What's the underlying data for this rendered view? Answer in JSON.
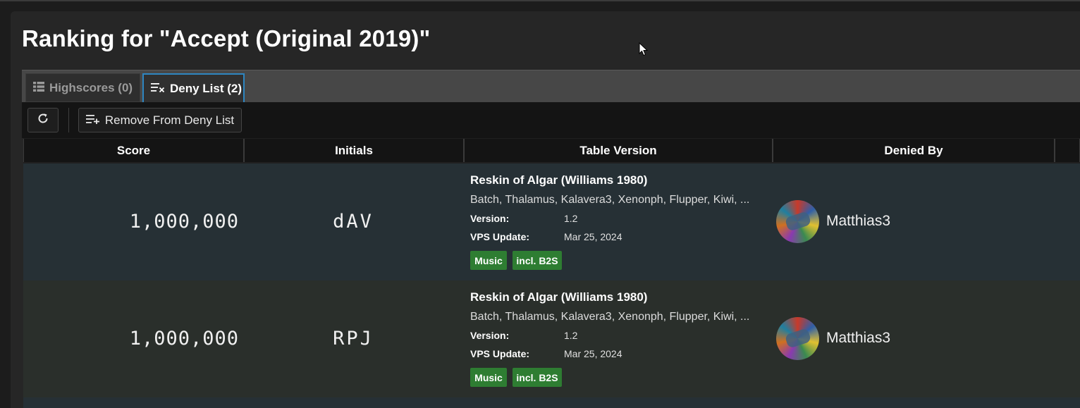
{
  "page": {
    "title": "Ranking for \"Accept (Original 2019)\""
  },
  "tabs": [
    {
      "label": "Highscores (0)",
      "icon": "list-icon",
      "active": false
    },
    {
      "label": "Deny List (2)",
      "icon": "deny-list-icon",
      "active": true
    }
  ],
  "toolbar": {
    "refresh_icon": "refresh-icon",
    "remove_label": "Remove From Deny List",
    "remove_icon": "playlist-add-icon"
  },
  "columns": [
    "Score",
    "Initials",
    "Table Version",
    "Denied By"
  ],
  "rows": [
    {
      "score": "1,000,000",
      "initials": "dAV",
      "table_title": "Reskin of Algar (Williams 1980)",
      "authors": "Batch, Thalamus, Kalavera3, Xenonph, Flupper, Kiwi, ...",
      "version_label": "Version:",
      "version": "1.2",
      "vps_label": "VPS Update:",
      "vps_update": "Mar 25, 2024",
      "tags": [
        "Music",
        "incl. B2S"
      ],
      "denied_by": "Matthias3"
    },
    {
      "score": "1,000,000",
      "initials": "RPJ",
      "table_title": "Reskin of Algar (Williams 1980)",
      "authors": "Batch, Thalamus, Kalavera3, Xenonph, Flupper, Kiwi, ...",
      "version_label": "Version:",
      "version": "1.2",
      "vps_label": "VPS Update:",
      "vps_update": "Mar 25, 2024",
      "tags": [
        "Music",
        "incl. B2S"
      ],
      "denied_by": "Matthias3"
    }
  ],
  "colors": {
    "tag_green": "#2e7d32",
    "active_tab_border": "#2e86c1",
    "row_bg_1": "#263035",
    "row_bg_2": "#2a2f2b"
  }
}
